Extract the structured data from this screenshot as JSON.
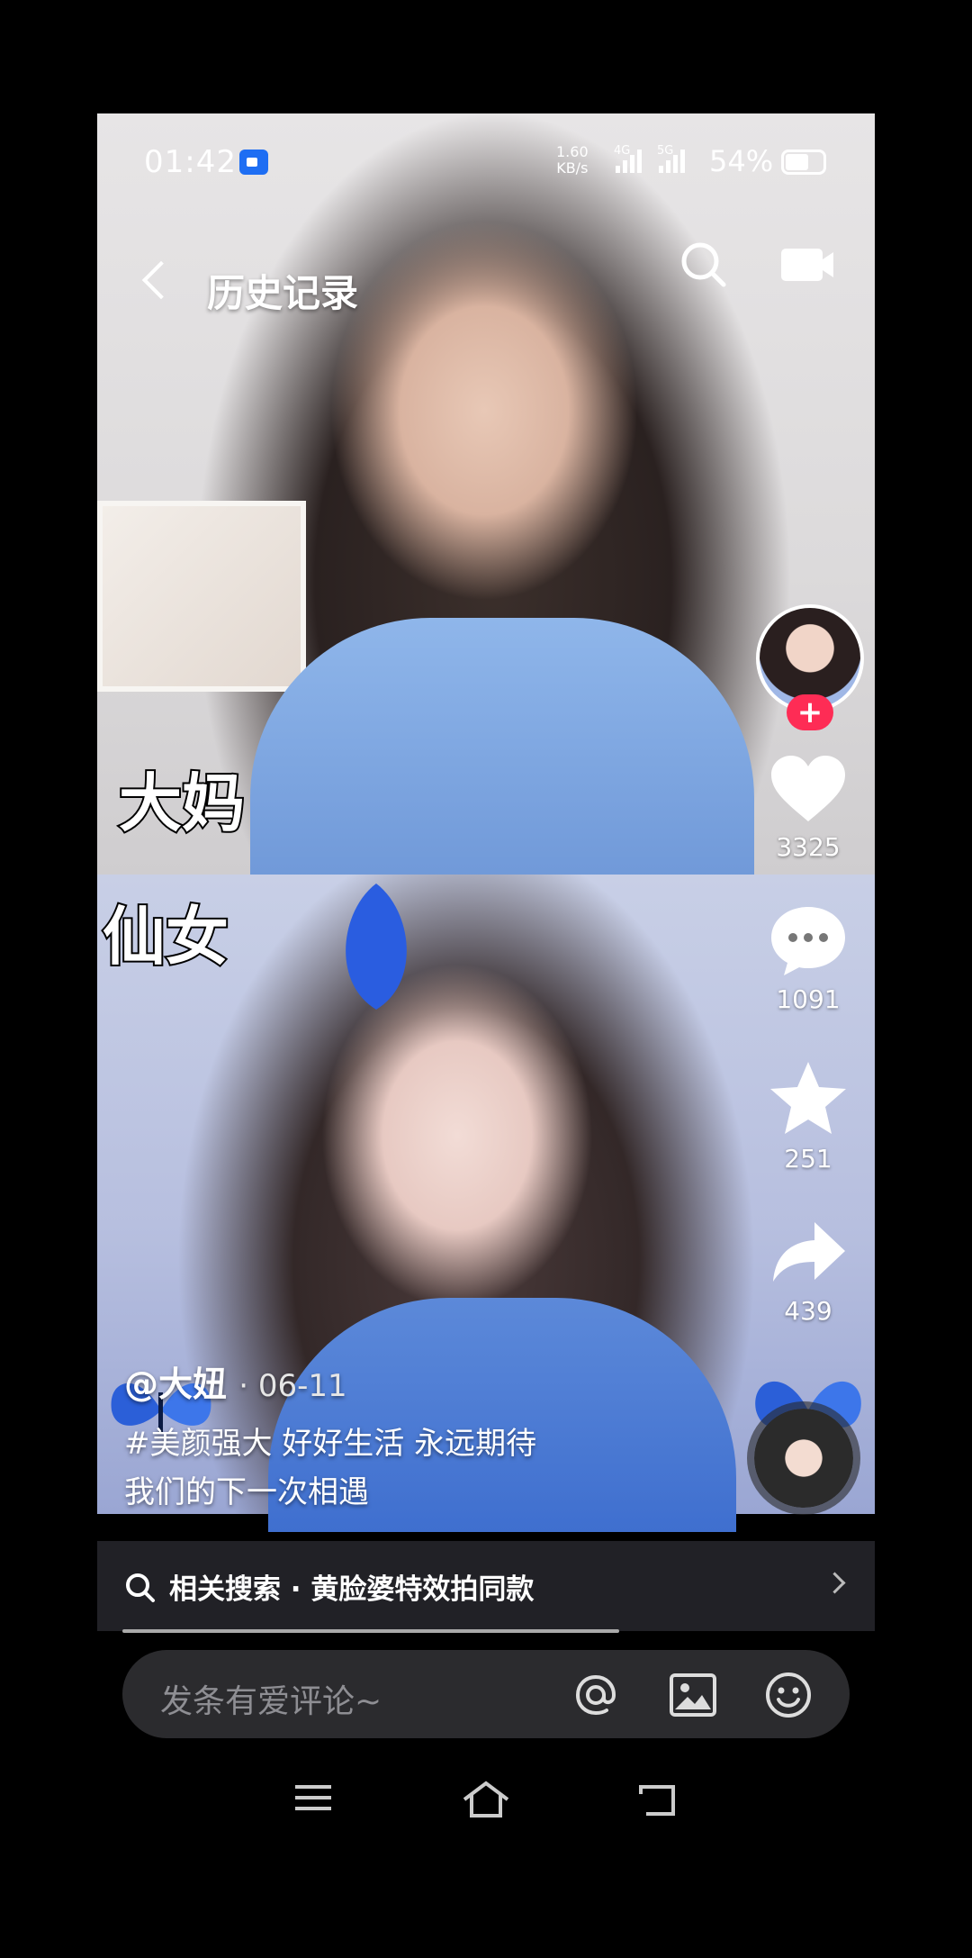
{
  "status_bar": {
    "time": "01:42",
    "net_speed": "1.60",
    "net_unit": "KB/s",
    "sig1": "4G",
    "sig2": "5G",
    "battery": "54%"
  },
  "nav": {
    "title": "历史记录"
  },
  "labels": {
    "top": "大妈",
    "bottom": "仙女"
  },
  "actions": {
    "likes": "3325",
    "comments": "1091",
    "favorites": "251",
    "shares": "439",
    "follow": "+"
  },
  "post": {
    "author": "@大妞",
    "date": "· 06-11",
    "caption_line1": "#美颜强大 好好生活 永远期待",
    "caption_line2": "我们的下一次相遇"
  },
  "related": {
    "text": "相关搜索 · 黄脸婆特效拍同款"
  },
  "comment": {
    "placeholder": "发条有爱评论~"
  },
  "colors": {
    "accent": "#fe2c55",
    "rec": "#1e6ef3"
  }
}
